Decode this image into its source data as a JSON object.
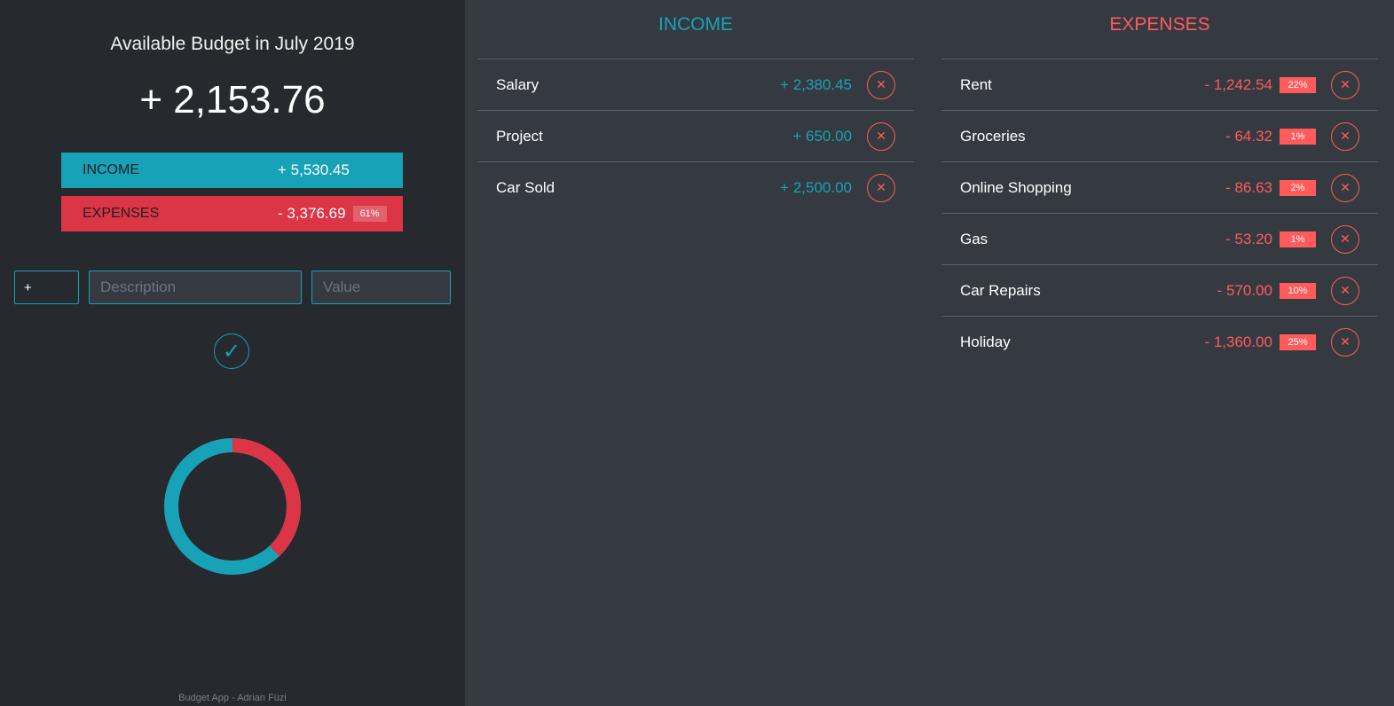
{
  "colors": {
    "income": "#17a2b8",
    "expenses": "#dc3545",
    "expense_text": "#ff5b5b",
    "left_bg": "#26292e",
    "right_bg": "#353a41"
  },
  "budget": {
    "title": "Available Budget in July 2019",
    "value": "+ 2,153.76"
  },
  "summary": {
    "income_label": "INCOME",
    "income_value": "+ 5,530.45",
    "expenses_label": "EXPENSES",
    "expenses_value": "- 3,376.69",
    "expenses_percent": "61%"
  },
  "form": {
    "type_value": "+",
    "description_placeholder": "Description",
    "value_placeholder": "Value",
    "submit_icon": "checkmark-icon",
    "submit_glyph": "✓"
  },
  "donut": {
    "income_fraction": 0.62,
    "expenses_fraction": 0.38
  },
  "income": {
    "title": "INCOME",
    "items": [
      {
        "description": "Salary",
        "value": "+ 2,380.45"
      },
      {
        "description": "Project",
        "value": "+ 650.00"
      },
      {
        "description": "Car Sold",
        "value": "+ 2,500.00"
      }
    ]
  },
  "expenses": {
    "title": "EXPENSES",
    "items": [
      {
        "description": "Rent",
        "value": "- 1,242.54",
        "percent": "22%"
      },
      {
        "description": "Groceries",
        "value": "- 64.32",
        "percent": "1%"
      },
      {
        "description": "Online Shopping",
        "value": "- 86.63",
        "percent": "2%"
      },
      {
        "description": "Gas",
        "value": "- 53.20",
        "percent": "1%"
      },
      {
        "description": "Car Repairs",
        "value": "- 570.00",
        "percent": "10%"
      },
      {
        "description": "Holiday",
        "value": "- 1,360.00",
        "percent": "25%"
      }
    ]
  },
  "delete_icon": "close-circle-icon",
  "delete_glyph": "✕",
  "footer": "Budget App - Adrian Füzi"
}
